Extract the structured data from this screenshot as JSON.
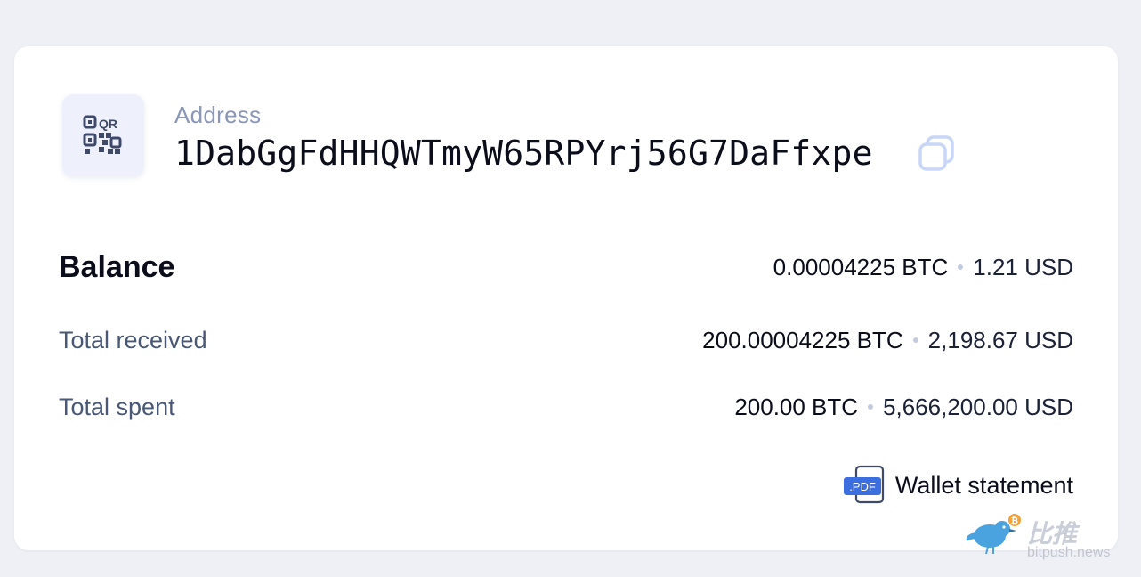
{
  "address": {
    "label": "Address",
    "value": "1DabGgFdHHQWTmyW65RPYrj56G7DaFfxpe",
    "qr_icon": "qr-code-icon",
    "copy_icon": "copy-icon"
  },
  "balance": {
    "title": "Balance",
    "btc": "0.00004225 BTC",
    "usd": "1.21 USD"
  },
  "received": {
    "label": "Total received",
    "btc": "200.00004225 BTC",
    "usd": "2,198.67 USD"
  },
  "spent": {
    "label": "Total spent",
    "btc": "200.00 BTC",
    "usd": "5,666,200.00 USD"
  },
  "statement": {
    "badge": ".PDF",
    "label": "Wallet statement",
    "icon": "pdf-file-icon"
  },
  "watermark": {
    "cn": "比推",
    "url": "bitpush.news"
  },
  "colors": {
    "background": "#eef0f5",
    "card": "#ffffff",
    "muted_label": "#8a97b8",
    "row_label": "#4a5878",
    "accent_blue": "#3b6fe0"
  }
}
